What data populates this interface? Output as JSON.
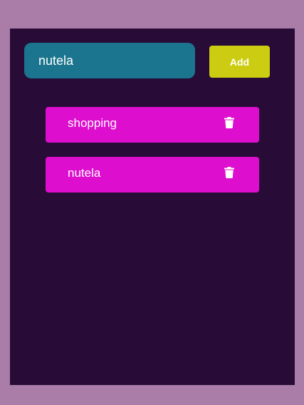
{
  "input": {
    "value": "nutela"
  },
  "add_button": {
    "label": "Add"
  },
  "todos": [
    {
      "text": "shopping",
      "icon": "trash-icon"
    },
    {
      "text": "nutela",
      "icon": "trash-icon"
    }
  ],
  "colors": {
    "page_background": "#aa7da8",
    "panel_background": "#280c37",
    "input_background": "#1b758e",
    "add_button_background": "#cccc13",
    "todo_item_background": "#dd0ecd",
    "text": "#ffffff"
  }
}
